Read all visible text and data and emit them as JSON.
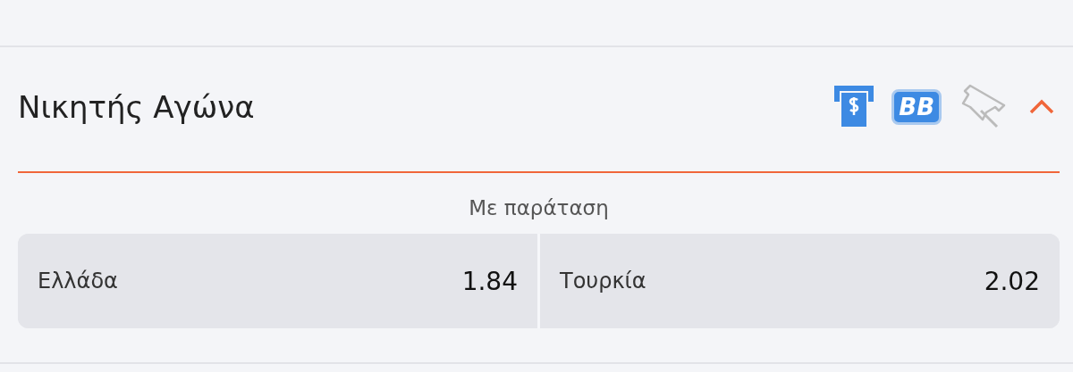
{
  "market": {
    "title": "Νικητής Αγώνα",
    "bet_builder_badge": "BB",
    "pinned": false,
    "expanded": true,
    "subtitle": "Με παράταση",
    "outcomes": [
      {
        "name": "Ελλάδα",
        "odds": "1.84"
      },
      {
        "name": "Τουρκία",
        "odds": "2.02"
      }
    ]
  }
}
